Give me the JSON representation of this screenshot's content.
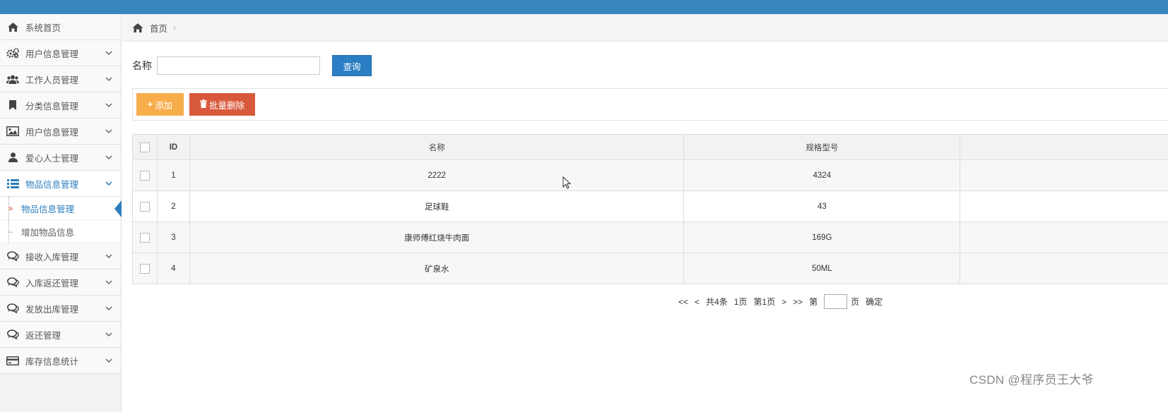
{
  "sidebar": {
    "items": [
      {
        "label": "系统首页",
        "icon": "home-icon"
      },
      {
        "label": "用户信息管理",
        "icon": "gears-icon"
      },
      {
        "label": "工作人员管理",
        "icon": "users-icon"
      },
      {
        "label": "分类信息管理",
        "icon": "bookmark-icon"
      },
      {
        "label": "用户信息管理",
        "icon": "picture-icon"
      },
      {
        "label": "爱心人士管理",
        "icon": "user-icon"
      },
      {
        "label": "物品信息管理",
        "icon": "list-icon"
      }
    ],
    "subitems": [
      {
        "label": "物品信息管理",
        "mark": "»"
      },
      {
        "label": "增加物品信息",
        "mark": "–"
      }
    ],
    "items_after": [
      {
        "label": "接收入库管理",
        "icon": "comments-icon"
      },
      {
        "label": "入库返还管理",
        "icon": "comments-icon"
      },
      {
        "label": "发放出库管理",
        "icon": "comments-icon"
      },
      {
        "label": "返还管理",
        "icon": "comments-icon"
      },
      {
        "label": "库存信息统计",
        "icon": "credit-card-icon"
      }
    ]
  },
  "breadcrumb": {
    "home": "首页",
    "separator": "›"
  },
  "search": {
    "label": "名称",
    "value": "",
    "button": "查询"
  },
  "toolbar": {
    "add_label": "添加",
    "add_icon": "+",
    "delete_label": "批量删除",
    "delete_icon": "🗑"
  },
  "table": {
    "headers": [
      "",
      "ID",
      "名称",
      "规格型号",
      ""
    ],
    "rows": [
      {
        "id": "1",
        "name": "2222",
        "spec": "4324"
      },
      {
        "id": "2",
        "name": "足球鞋",
        "spec": "43"
      },
      {
        "id": "3",
        "name": "康师傅红烧牛肉面",
        "spec": "169G"
      },
      {
        "id": "4",
        "name": "矿泉水",
        "spec": "50ML"
      }
    ]
  },
  "pagination": {
    "first": "<<",
    "prev": "<",
    "total": "共4条",
    "pages": "1页",
    "current": "第1页",
    "next": ">",
    "last": ">>",
    "goto_prefix": "第",
    "goto_suffix": "页",
    "confirm": "确定"
  },
  "watermark": "CSDN @程序员王大爷",
  "colors": {
    "topbar": "#3a87bd",
    "primary": "#2a7fc4",
    "add": "#f8ad4b",
    "delete": "#d9593c",
    "active": "#2b7dbc"
  }
}
